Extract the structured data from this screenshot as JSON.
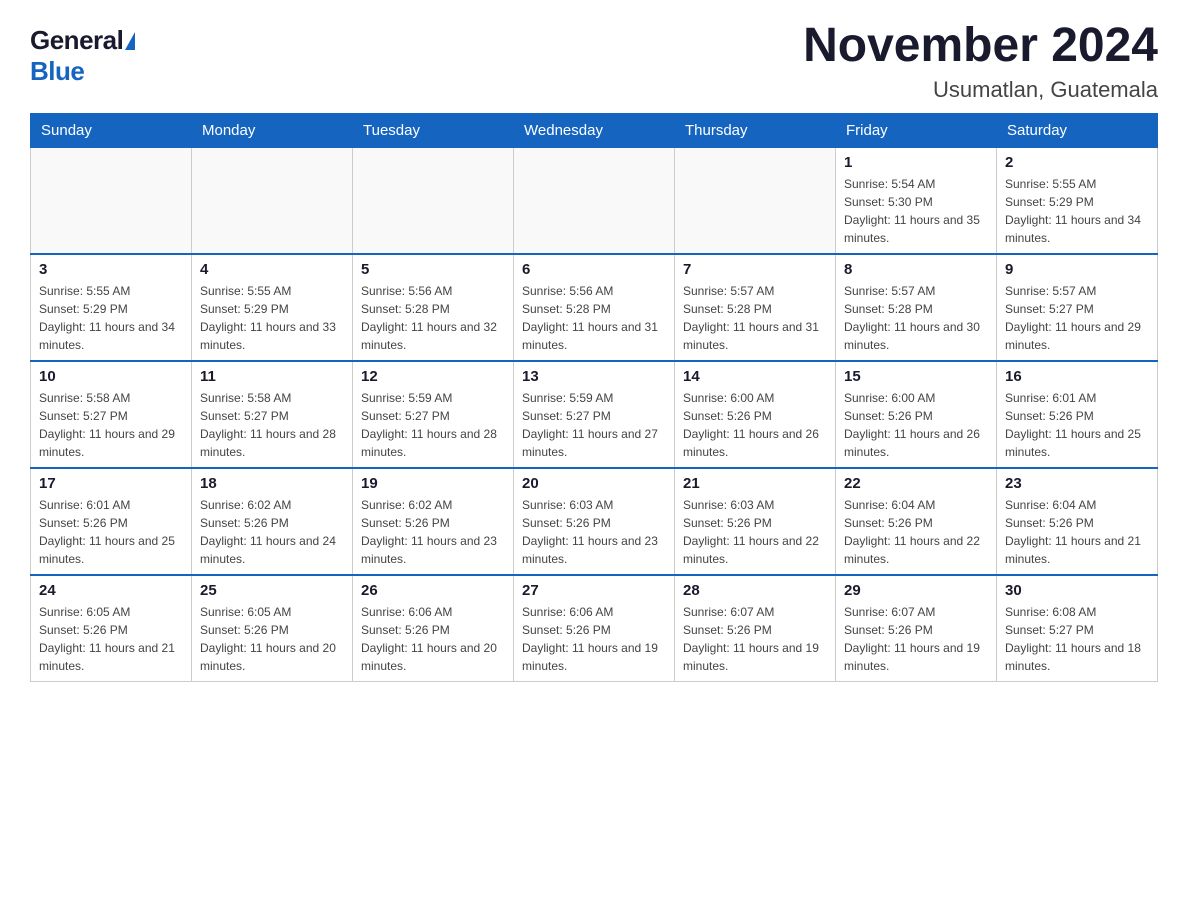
{
  "logo": {
    "general": "General",
    "blue": "Blue"
  },
  "title": "November 2024",
  "subtitle": "Usumatlan, Guatemala",
  "days_of_week": [
    "Sunday",
    "Monday",
    "Tuesday",
    "Wednesday",
    "Thursday",
    "Friday",
    "Saturday"
  ],
  "weeks": [
    [
      {
        "day": "",
        "info": ""
      },
      {
        "day": "",
        "info": ""
      },
      {
        "day": "",
        "info": ""
      },
      {
        "day": "",
        "info": ""
      },
      {
        "day": "",
        "info": ""
      },
      {
        "day": "1",
        "info": "Sunrise: 5:54 AM\nSunset: 5:30 PM\nDaylight: 11 hours and 35 minutes."
      },
      {
        "day": "2",
        "info": "Sunrise: 5:55 AM\nSunset: 5:29 PM\nDaylight: 11 hours and 34 minutes."
      }
    ],
    [
      {
        "day": "3",
        "info": "Sunrise: 5:55 AM\nSunset: 5:29 PM\nDaylight: 11 hours and 34 minutes."
      },
      {
        "day": "4",
        "info": "Sunrise: 5:55 AM\nSunset: 5:29 PM\nDaylight: 11 hours and 33 minutes."
      },
      {
        "day": "5",
        "info": "Sunrise: 5:56 AM\nSunset: 5:28 PM\nDaylight: 11 hours and 32 minutes."
      },
      {
        "day": "6",
        "info": "Sunrise: 5:56 AM\nSunset: 5:28 PM\nDaylight: 11 hours and 31 minutes."
      },
      {
        "day": "7",
        "info": "Sunrise: 5:57 AM\nSunset: 5:28 PM\nDaylight: 11 hours and 31 minutes."
      },
      {
        "day": "8",
        "info": "Sunrise: 5:57 AM\nSunset: 5:28 PM\nDaylight: 11 hours and 30 minutes."
      },
      {
        "day": "9",
        "info": "Sunrise: 5:57 AM\nSunset: 5:27 PM\nDaylight: 11 hours and 29 minutes."
      }
    ],
    [
      {
        "day": "10",
        "info": "Sunrise: 5:58 AM\nSunset: 5:27 PM\nDaylight: 11 hours and 29 minutes."
      },
      {
        "day": "11",
        "info": "Sunrise: 5:58 AM\nSunset: 5:27 PM\nDaylight: 11 hours and 28 minutes."
      },
      {
        "day": "12",
        "info": "Sunrise: 5:59 AM\nSunset: 5:27 PM\nDaylight: 11 hours and 28 minutes."
      },
      {
        "day": "13",
        "info": "Sunrise: 5:59 AM\nSunset: 5:27 PM\nDaylight: 11 hours and 27 minutes."
      },
      {
        "day": "14",
        "info": "Sunrise: 6:00 AM\nSunset: 5:26 PM\nDaylight: 11 hours and 26 minutes."
      },
      {
        "day": "15",
        "info": "Sunrise: 6:00 AM\nSunset: 5:26 PM\nDaylight: 11 hours and 26 minutes."
      },
      {
        "day": "16",
        "info": "Sunrise: 6:01 AM\nSunset: 5:26 PM\nDaylight: 11 hours and 25 minutes."
      }
    ],
    [
      {
        "day": "17",
        "info": "Sunrise: 6:01 AM\nSunset: 5:26 PM\nDaylight: 11 hours and 25 minutes."
      },
      {
        "day": "18",
        "info": "Sunrise: 6:02 AM\nSunset: 5:26 PM\nDaylight: 11 hours and 24 minutes."
      },
      {
        "day": "19",
        "info": "Sunrise: 6:02 AM\nSunset: 5:26 PM\nDaylight: 11 hours and 23 minutes."
      },
      {
        "day": "20",
        "info": "Sunrise: 6:03 AM\nSunset: 5:26 PM\nDaylight: 11 hours and 23 minutes."
      },
      {
        "day": "21",
        "info": "Sunrise: 6:03 AM\nSunset: 5:26 PM\nDaylight: 11 hours and 22 minutes."
      },
      {
        "day": "22",
        "info": "Sunrise: 6:04 AM\nSunset: 5:26 PM\nDaylight: 11 hours and 22 minutes."
      },
      {
        "day": "23",
        "info": "Sunrise: 6:04 AM\nSunset: 5:26 PM\nDaylight: 11 hours and 21 minutes."
      }
    ],
    [
      {
        "day": "24",
        "info": "Sunrise: 6:05 AM\nSunset: 5:26 PM\nDaylight: 11 hours and 21 minutes."
      },
      {
        "day": "25",
        "info": "Sunrise: 6:05 AM\nSunset: 5:26 PM\nDaylight: 11 hours and 20 minutes."
      },
      {
        "day": "26",
        "info": "Sunrise: 6:06 AM\nSunset: 5:26 PM\nDaylight: 11 hours and 20 minutes."
      },
      {
        "day": "27",
        "info": "Sunrise: 6:06 AM\nSunset: 5:26 PM\nDaylight: 11 hours and 19 minutes."
      },
      {
        "day": "28",
        "info": "Sunrise: 6:07 AM\nSunset: 5:26 PM\nDaylight: 11 hours and 19 minutes."
      },
      {
        "day": "29",
        "info": "Sunrise: 6:07 AM\nSunset: 5:26 PM\nDaylight: 11 hours and 19 minutes."
      },
      {
        "day": "30",
        "info": "Sunrise: 6:08 AM\nSunset: 5:27 PM\nDaylight: 11 hours and 18 minutes."
      }
    ]
  ]
}
